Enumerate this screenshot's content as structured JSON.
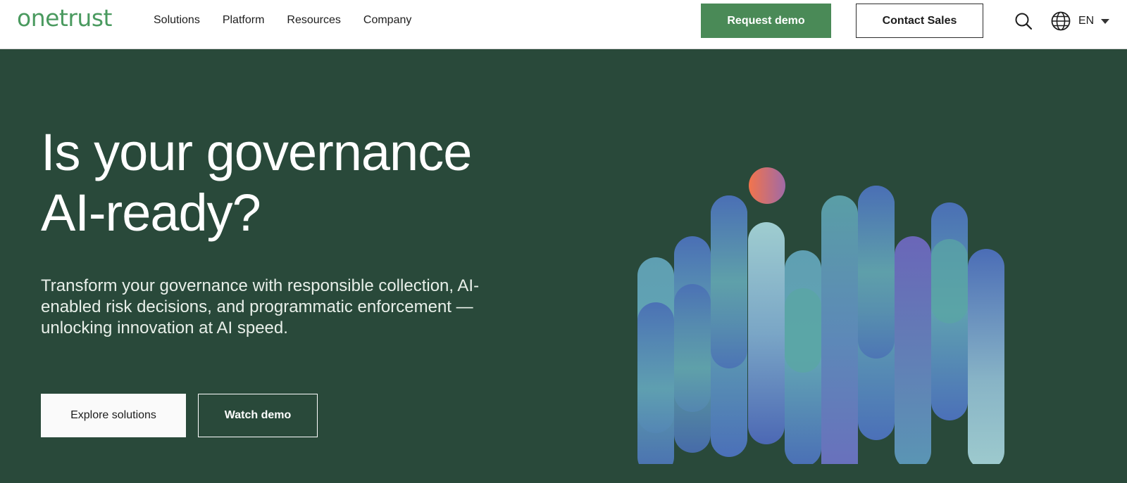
{
  "brand": {
    "logo_text": "onetrust",
    "logo_color": "#4a9a5f"
  },
  "nav": {
    "items": [
      "Solutions",
      "Platform",
      "Resources",
      "Company"
    ]
  },
  "header_actions": {
    "request_demo_label": "Request demo",
    "contact_sales_label": "Contact Sales",
    "search_icon": "search-icon",
    "language_icon": "globe-icon",
    "language_code": "EN"
  },
  "hero": {
    "headline_line1": "Is your governance",
    "headline_line2": "AI-ready?",
    "subtext": "Transform your governance with responsible collection, AI-enabled risk decisions, and programmatic enforcement — unlocking innovation at AI speed.",
    "explore_label": "Explore solutions",
    "watch_label": "Watch demo",
    "background_color": "#29493a"
  },
  "colors": {
    "accent_green": "#4a8a57",
    "art_blue": "#4a6fb5",
    "art_teal": "#64a6b0",
    "art_purple": "#6a6ab8",
    "art_orb": "#e8704f"
  }
}
